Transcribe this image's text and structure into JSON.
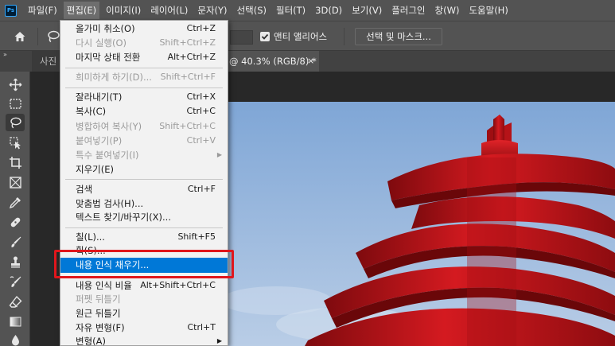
{
  "app": {
    "logo": "Ps"
  },
  "menubar": {
    "items": [
      {
        "label": "파일(F)"
      },
      {
        "label": "편집(E)"
      },
      {
        "label": "이미지(I)"
      },
      {
        "label": "레이어(L)"
      },
      {
        "label": "문자(Y)"
      },
      {
        "label": "선택(S)"
      },
      {
        "label": "필터(T)"
      },
      {
        "label": "3D(D)"
      },
      {
        "label": "보기(V)"
      },
      {
        "label": "플러그인"
      },
      {
        "label": "창(W)"
      },
      {
        "label": "도움말(H)"
      }
    ]
  },
  "options": {
    "antialias_label": "앤티 앨리어스",
    "antialias_checked": true,
    "select_mask_label": "선택 및 마스크..."
  },
  "tabs": {
    "photo_partial": "사진",
    "active_suffix": "@ 40.3% (RGB/8) *",
    "close": "×",
    "collapse": "»"
  },
  "edit_menu": {
    "items": [
      {
        "label": "올가미 취소(O)",
        "shortcut": "Ctrl+Z",
        "disabled": false
      },
      {
        "label": "다시 실행(O)",
        "shortcut": "Shift+Ctrl+Z",
        "disabled": true
      },
      {
        "label": "마지막 상태 전환",
        "shortcut": "Alt+Ctrl+Z",
        "disabled": false
      },
      {
        "label": "희미하게 하기(D)...",
        "shortcut": "Shift+Ctrl+F",
        "disabled": true
      },
      {
        "label": "잘라내기(T)",
        "shortcut": "Ctrl+X",
        "disabled": false
      },
      {
        "label": "복사(C)",
        "shortcut": "Ctrl+C",
        "disabled": false
      },
      {
        "label": "병합하여 복사(Y)",
        "shortcut": "Shift+Ctrl+C",
        "disabled": true
      },
      {
        "label": "붙여넣기(P)",
        "shortcut": "Ctrl+V",
        "disabled": true
      },
      {
        "label": "특수 붙여넣기(I)",
        "shortcut": "",
        "disabled": true,
        "submenu": true
      },
      {
        "label": "지우기(E)",
        "shortcut": "",
        "disabled": false
      },
      {
        "label": "검색",
        "shortcut": "Ctrl+F",
        "disabled": false
      },
      {
        "label": "맞춤법 검사(H)...",
        "shortcut": "",
        "disabled": false
      },
      {
        "label": "텍스트 찾기/바꾸기(X)...",
        "shortcut": "",
        "disabled": false
      },
      {
        "label": "칠(L)...",
        "shortcut": "Shift+F5",
        "disabled": false
      },
      {
        "label": "획(S)...",
        "shortcut": "",
        "disabled": false
      },
      {
        "label": "내용 인식 채우기...",
        "shortcut": "",
        "disabled": false,
        "highlighted": true
      },
      {
        "label": "내용 인식 비율",
        "shortcut": "Alt+Shift+Ctrl+C",
        "disabled": false
      },
      {
        "label": "퍼펫 뒤틀기",
        "shortcut": "",
        "disabled": true
      },
      {
        "label": "원근 뒤틀기",
        "shortcut": "",
        "disabled": false
      },
      {
        "label": "자유 변형(F)",
        "shortcut": "Ctrl+T",
        "disabled": false
      },
      {
        "label": "변형(A)",
        "shortcut": "",
        "disabled": false,
        "submenu": true
      }
    ],
    "arrow": "▶"
  },
  "colors": {
    "menu_highlight": "#0078d7",
    "annotation_frame": "#e0161c",
    "sculpture_red": "#c8161c",
    "sky": "#8fb1d9"
  }
}
